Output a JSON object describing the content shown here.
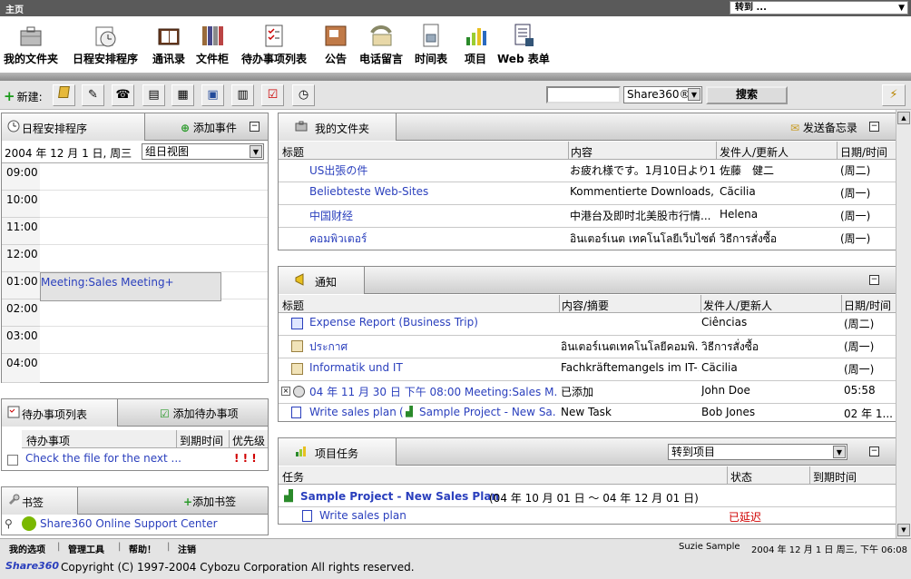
{
  "topbar": {
    "title": "主页",
    "goto_label": "转到 ...",
    "goto_arrow": "▼"
  },
  "apps": [
    {
      "label": "我的文件夹",
      "icon": "briefcase-icon"
    },
    {
      "label": "日程安排程序",
      "icon": "clock-icon"
    },
    {
      "label": "通讯录",
      "icon": "address-book-icon"
    },
    {
      "label": "文件柜",
      "icon": "binders-icon"
    },
    {
      "label": "待办事项列表",
      "icon": "checklist-icon"
    },
    {
      "label": "公告",
      "icon": "bulletin-icon"
    },
    {
      "label": "电话留言",
      "icon": "phone-icon"
    },
    {
      "label": "时间表",
      "icon": "timecard-icon"
    },
    {
      "label": "项目",
      "icon": "bar-chart-icon"
    },
    {
      "label": "Web 表单",
      "icon": "form-icon"
    }
  ],
  "toolbar": {
    "new_label": "新建:",
    "search_value": "",
    "scope_value": "Share360®",
    "search_button": "搜索"
  },
  "scheduler": {
    "title": "日程安排程序",
    "action": "添加事件",
    "date": "2004 年 12 月 1 日, 周三",
    "view": "组日视图",
    "times": [
      "09:00",
      "10:00",
      "11:00",
      "12:00",
      "01:00",
      "02:00",
      "03:00",
      "04:00"
    ],
    "event": "Meeting:Sales Meeting+"
  },
  "todo": {
    "title": "待办事项列表",
    "action": "添加待办事项",
    "headers": [
      "待办事项",
      "到期时间",
      "优先级"
    ],
    "items": [
      {
        "task": "Check the file for the next ...",
        "due": "",
        "priority": "! ! !"
      }
    ]
  },
  "bookmarks": {
    "title": "书签",
    "action": "添加书签",
    "items": [
      "Share360 Online Support Center"
    ]
  },
  "myfolder": {
    "title": "我的文件夹",
    "action": "发送备忘录",
    "headers": [
      "标题",
      "内容",
      "发件人/更新人",
      "日期/时间"
    ],
    "rows": [
      {
        "title": "US出張の件",
        "content": "お疲れ様です。1月10日より1...",
        "sender": "佐藤　健二",
        "date": "(周二)"
      },
      {
        "title": "Beliebteste Web-Sites",
        "content": "Kommentierte Downloads,...",
        "sender": "Cãcilia",
        "date": "(周一)"
      },
      {
        "title": "中国财经",
        "content": "中港台及即时北美股市行情...",
        "sender": "Helena",
        "date": "(周一)"
      },
      {
        "title": "คอมพิวเตอร์",
        "content": "อินเตอร์เนต เทคโนโลยีเว็บไซต์",
        "sender": "วิธีการสั่งซื้อ",
        "date": "(周一)"
      }
    ]
  },
  "notices": {
    "title": "通知",
    "headers": [
      "标题",
      "内容/摘要",
      "发件人/更新人",
      "日期/时间"
    ],
    "rows": [
      {
        "title": "Expense Report (Business Trip)",
        "content": "",
        "sender": "Ciências",
        "date": "(周二)",
        "icon": "report-icon"
      },
      {
        "title": "ประกาศ",
        "content": "อินเตอร์เนตเทคโนโลยีคอมพิ...",
        "sender": "วิธีการสั่งซื้อ",
        "date": "(周一)",
        "icon": "note-icon"
      },
      {
        "title": "Informatik und IT",
        "content": "Fachkräftemangels im IT-...",
        "sender": "Cäcilia",
        "date": "(周一)",
        "icon": "note-icon"
      },
      {
        "title": "04 年 11 月 30 日 下午 08:00  Meeting:Sales M...",
        "content": "已添加",
        "sender": "John Doe",
        "date": "05:58",
        "icon": "clock-icon"
      },
      {
        "title": "Write sales plan",
        "project": "Sample Project - New Sa...",
        "content": "New Task",
        "sender": "Bob Jones",
        "date": "02 年 1...",
        "icon": "task-icon"
      }
    ]
  },
  "project_tasks": {
    "title": "项目任务",
    "goto": "转到项目",
    "headers": [
      "任务",
      "状态",
      "到期时间"
    ],
    "project": "Sample Project - New Sales Plan",
    "project_range": "(04 年 10 月 01 日 ～ 04 年 12 月 01 日)",
    "tasks": [
      {
        "name": "Write sales plan",
        "status": "已延迟"
      }
    ]
  },
  "footer": {
    "links": [
      "我的选项",
      "管理工具",
      "帮助！",
      "注销"
    ],
    "user": "Suzie Sample",
    "datetime": "2004 年 12 月 1 日 周三, 下午 06:08",
    "copyright": "Copyright (C) 1997-2004 Cybozu Corporation All rights reserved.",
    "logo": "Share360"
  },
  "colors": {
    "link": "#2a3fbd",
    "priority": "#d00000",
    "delayed": "#d00000",
    "event_bg": "#e3e3e3"
  }
}
